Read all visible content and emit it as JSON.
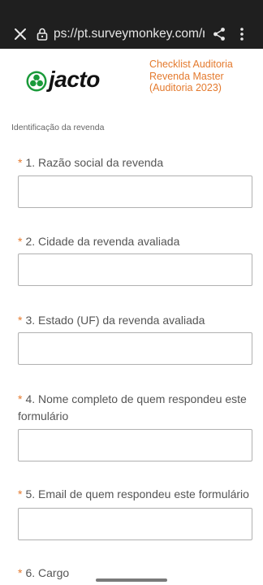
{
  "browser": {
    "url": "ps://pt.surveymonkey.com/r",
    "icons": [
      "close-icon",
      "lock-icon",
      "share-icon",
      "more-vert-icon"
    ]
  },
  "header": {
    "logo_text": "jacto",
    "survey_title": "Checklist Auditoria Revenda Master (Auditoria 2023)"
  },
  "section_title": "Identificação da revenda",
  "required_mark": "*",
  "questions": [
    {
      "label": "1. Razão social da revenda",
      "value": ""
    },
    {
      "label": "2. Cidade da revenda avaliada",
      "value": ""
    },
    {
      "label": "3. Estado (UF) da revenda avaliada",
      "value": ""
    },
    {
      "label": "4. Nome completo de quem respondeu este formulário",
      "value": ""
    },
    {
      "label": "5. Email de quem respondeu este formulário",
      "value": ""
    },
    {
      "label": "6. Cargo",
      "value": ""
    }
  ],
  "colors": {
    "accent": "#e47a2e",
    "browser_bar": "#1f1f1f",
    "logo_green": "#1a9a3a"
  }
}
